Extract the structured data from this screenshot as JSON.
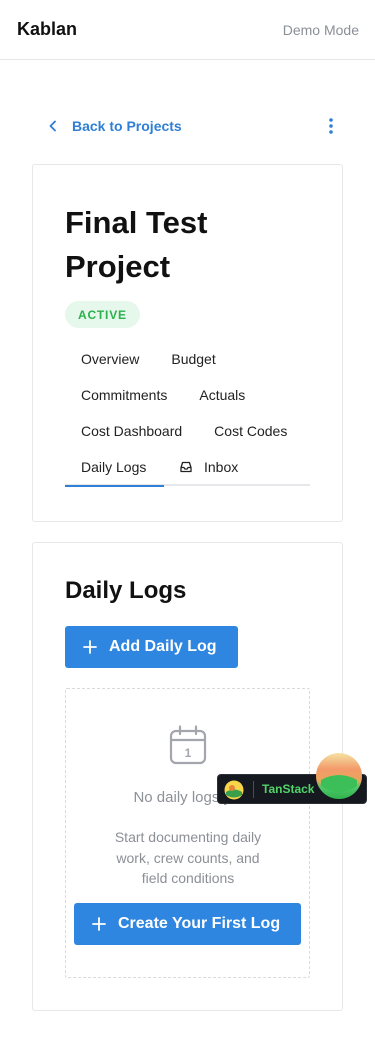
{
  "header": {
    "brand": "Kablan",
    "mode": "Demo Mode"
  },
  "nav": {
    "back_label": "Back to Projects"
  },
  "project": {
    "title": "Final Test Project",
    "status": "ACTIVE",
    "tabs_row1": [
      "Overview",
      "Budget"
    ],
    "tabs_row2": [
      "Commitments",
      "Actuals"
    ],
    "tabs_row3": [
      "Cost Dashboard",
      "Cost Codes"
    ],
    "tabs_row4": [
      "Daily Logs",
      "Inbox"
    ],
    "active_tab": "Daily Logs"
  },
  "daily_logs": {
    "title": "Daily Logs",
    "add_button": "Add Daily Log",
    "empty_title": "No daily logs yet",
    "empty_description": "Start documenting daily work, crew counts, and field conditions",
    "create_button": "Create Your First Log",
    "calendar_day": "1"
  },
  "devtools": {
    "label": "TanStack"
  },
  "colors": {
    "accent": "#2f86e0",
    "link": "#2f7fd6",
    "active_badge_bg": "#e6f7ec",
    "active_badge_text": "#2bb24c"
  },
  "icons": [
    "chevron-left-icon",
    "more-vertical-icon",
    "inbox-icon",
    "plus-icon",
    "calendar-icon",
    "tanstack-logo-icon"
  ]
}
